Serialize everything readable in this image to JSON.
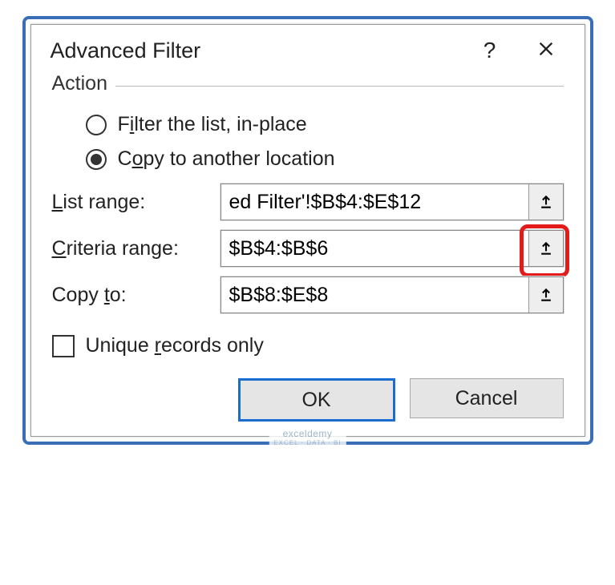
{
  "dialog": {
    "title": "Advanced Filter",
    "help_symbol": "?",
    "close_label": "Close"
  },
  "action": {
    "legend": "Action",
    "option_filter_pre": "F",
    "option_filter_u": "i",
    "option_filter_post": "lter the list, in-place",
    "option_copy_pre": "C",
    "option_copy_u": "o",
    "option_copy_post": "py to another location",
    "selected": "copy"
  },
  "ranges": {
    "list_label_u": "L",
    "list_label_rest": "ist range:",
    "list_value": "ed Filter'!$B$4:$E$12",
    "criteria_label_u": "C",
    "criteria_label_rest": "riteria range:",
    "criteria_value": "$B$4:$B$6",
    "copyto_label_pre": "Copy ",
    "copyto_label_u": "t",
    "copyto_label_post": "o:",
    "copyto_value": "$B$8:$E$8"
  },
  "unique": {
    "pre": "Unique ",
    "u": "r",
    "post": "ecords only",
    "checked": false
  },
  "buttons": {
    "ok": "OK",
    "cancel": "Cancel"
  },
  "watermark": {
    "main": "exceldemy",
    "sub": "EXCEL · DATA · BI"
  }
}
